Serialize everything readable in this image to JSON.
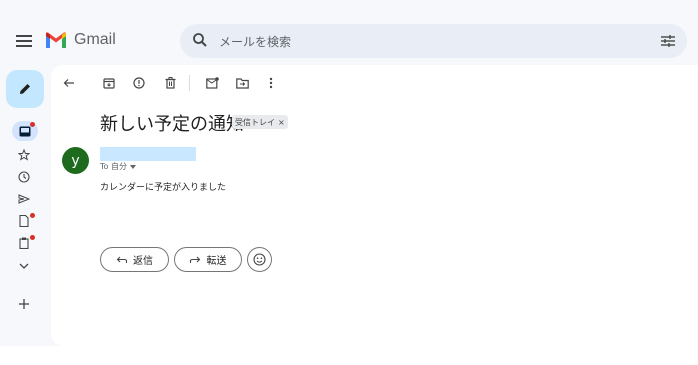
{
  "app": {
    "name": "Gmail"
  },
  "header": {
    "menu_icon": "hamburger-menu-icon",
    "search_placeholder": "メールを検索",
    "search_icon": "search-icon",
    "filter_icon": "search-options-icon"
  },
  "rail": {
    "compose_icon": "pencil-icon",
    "items": [
      {
        "icon": "inbox-icon",
        "badge": true,
        "active": true
      },
      {
        "icon": "star-icon",
        "badge": false
      },
      {
        "icon": "clock-icon",
        "badge": false
      },
      {
        "icon": "send-icon",
        "badge": false
      },
      {
        "icon": "document-icon",
        "badge": true
      },
      {
        "icon": "clipboard-icon",
        "badge": true
      },
      {
        "icon": "chevron-down-icon",
        "badge": false
      },
      {
        "icon": "plus-icon",
        "badge": false
      }
    ]
  },
  "toolbar": {
    "icons": [
      "back-arrow-icon",
      "archive-icon",
      "report-spam-icon",
      "delete-icon",
      "mark-unread-icon",
      "move-to-icon",
      "more-vert-icon"
    ]
  },
  "message": {
    "subject": "新しい予定の通知",
    "label": "受信トレイ",
    "label_close": "×",
    "avatar_initial": "y",
    "to": "To 自分",
    "body": "カレンダーに予定が入りました"
  },
  "actions": {
    "reply": "返信",
    "forward": "転送"
  },
  "colors": {
    "app_bg": "#f6f8fc",
    "compose_bg": "#c2e7ff",
    "avatar_bg": "#1e6b1e",
    "badge": "#d93025"
  }
}
